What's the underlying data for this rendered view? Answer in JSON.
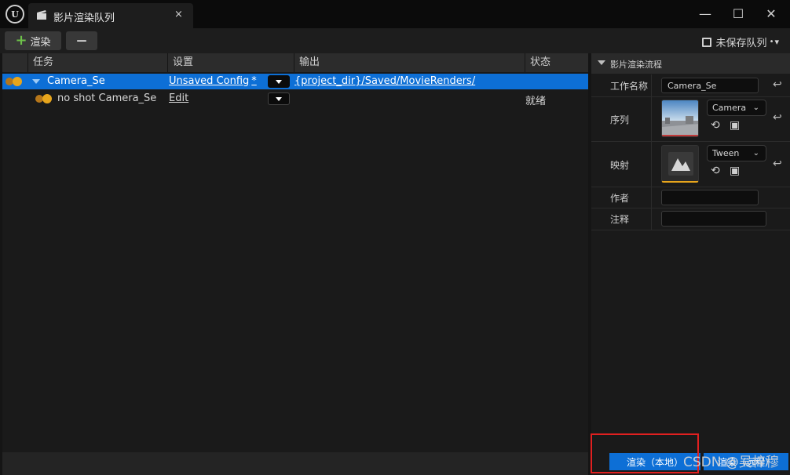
{
  "window": {
    "tab_title": "影片渲染队列",
    "tab_close": "×",
    "controls": {
      "minimize": "—",
      "maximize": "☐",
      "close": "✕"
    }
  },
  "toolbar": {
    "render_label": "渲染",
    "remove_label": "—",
    "queue_status": "未保存队列",
    "queue_suffix": "•",
    "queue_caret": "▾"
  },
  "table": {
    "columns": [
      "任务",
      "设置",
      "输出",
      "状态"
    ],
    "rows": [
      {
        "name": "Camera_Se",
        "config": "Unsaved Config",
        "config_mark": "*",
        "output": "{project_dir}/Saved/MovieRenders/",
        "status": "",
        "expanded": true,
        "selected": true
      },
      {
        "name": "no shot Camera_Se",
        "config": "Edit",
        "output": "",
        "status": "就绪"
      }
    ]
  },
  "pipeline": {
    "title": "影片渲染流程",
    "job_name_label": "工作名称",
    "job_name_value": "Camera_Se",
    "sequence_label": "序列",
    "sequence_value": "Camera",
    "mapping_label": "映射",
    "mapping_value": "Tween",
    "author_label": "作者",
    "author_value": "",
    "comment_label": "注释",
    "comment_value": ""
  },
  "footer": {
    "render_local_label": "渲染（本地）",
    "render_remote_label": "渲染（远程）"
  },
  "watermark": "CSDN @吴梓穆",
  "colors": {
    "accent": "#0d6fd6",
    "toggle_on": "#e7a51c",
    "add_icon": "#6ec24a",
    "highlight_box": "#e02020"
  },
  "icons": [
    "unreal-logo-icon",
    "clapperboard-icon",
    "plus-icon",
    "minus-icon",
    "save-icon",
    "chevron-down-icon",
    "reset-arrow-icon",
    "browse-icon",
    "search-asset-icon",
    "collapse-triangle-icon"
  ]
}
